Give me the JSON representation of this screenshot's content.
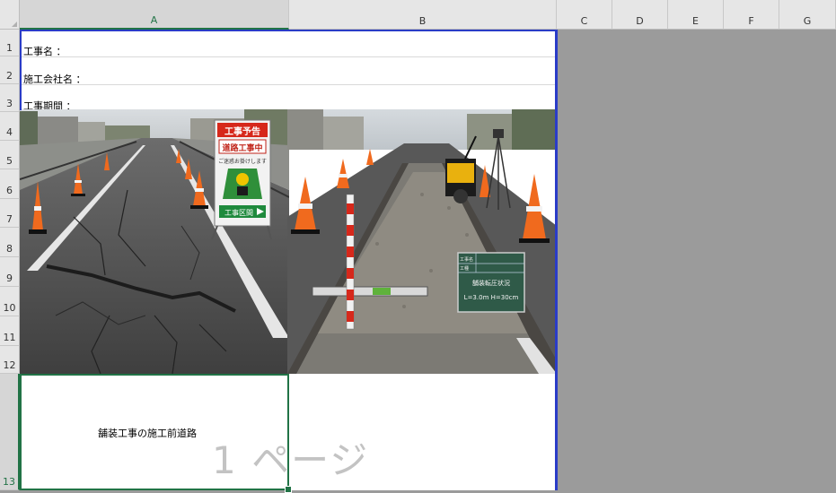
{
  "columns": [
    "A",
    "B",
    "C",
    "D",
    "E",
    "F",
    "G"
  ],
  "rows": [
    "1",
    "2",
    "3",
    "4",
    "5",
    "6",
    "7",
    "8",
    "9",
    "10",
    "11",
    "12",
    "13"
  ],
  "cells": {
    "a1": "工事名 ：",
    "a2": "施工会社名 ：",
    "a3": "工事期間 ："
  },
  "sign": {
    "header": "工事予告",
    "title": "道路工事中",
    "sub": "ご迷惑お掛けします",
    "foot": "工事区間"
  },
  "board": {
    "r1": "工事名",
    "r2": "工種",
    "r3": "舗装転圧状況",
    "r4": "L=3.0m H=30cm"
  },
  "caption": "舗装工事の施工前道路",
  "watermark": "1 ページ",
  "colors": {
    "selection": "#217346",
    "page_border": "#2a3cc7",
    "background": "#9b9b9b"
  }
}
